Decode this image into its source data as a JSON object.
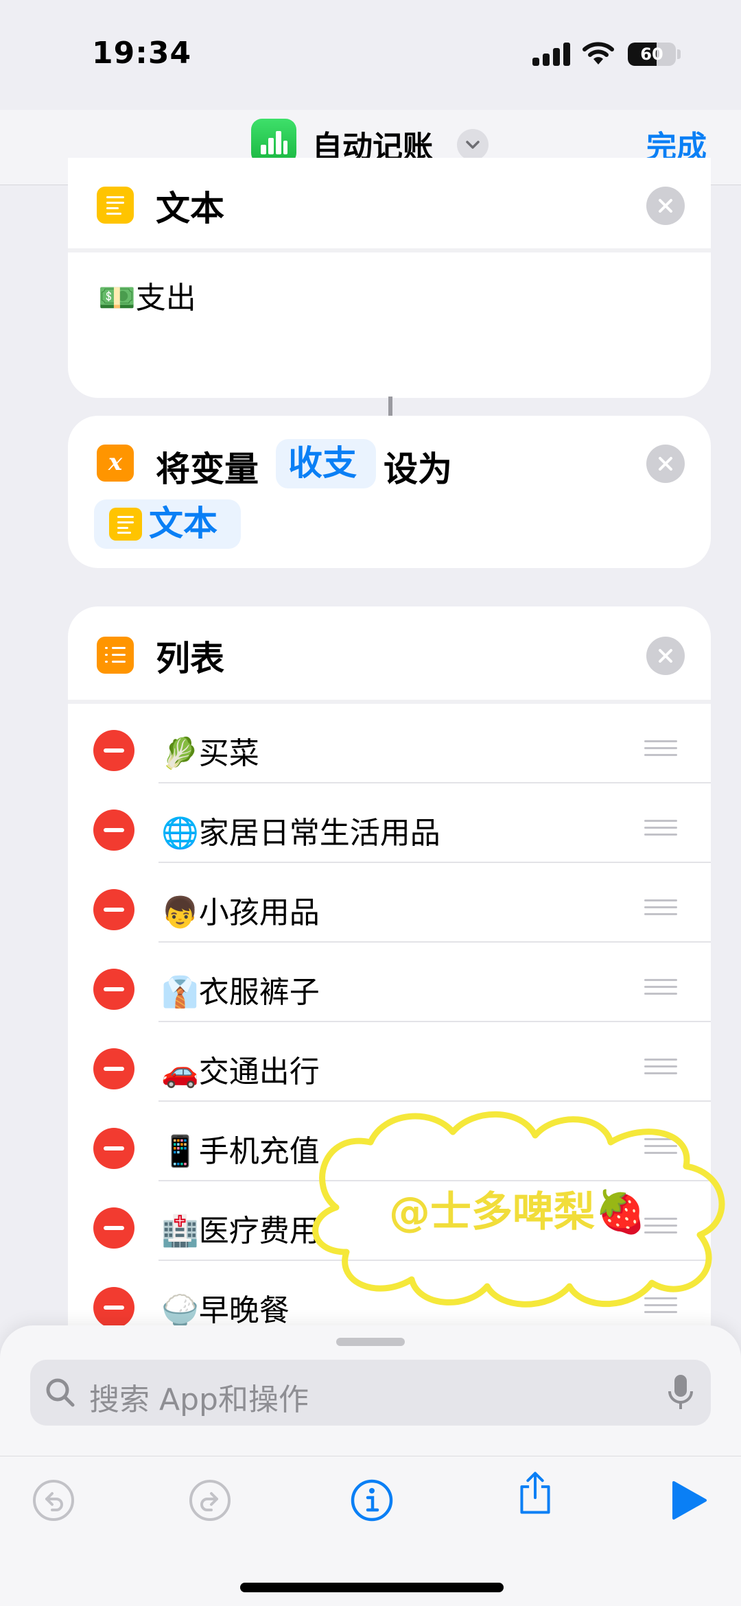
{
  "status_bar": {
    "time": "19:34",
    "battery_level": "60",
    "battery_percent": 60
  },
  "nav": {
    "title": "自动记账",
    "done_label": "完成"
  },
  "text_action": {
    "title": "文本",
    "content": "💵支出"
  },
  "set_variable": {
    "prefix": "将变量",
    "variable": "收支",
    "middle": "设为",
    "value": "文本"
  },
  "list_action": {
    "title": "列表",
    "items": [
      {
        "label": "🥬买菜"
      },
      {
        "label": "🌐家居日常生活用品"
      },
      {
        "label": "👦小孩用品"
      },
      {
        "label": "👔衣服裤子"
      },
      {
        "label": "🚗交通出行"
      },
      {
        "label": "📱手机充值"
      },
      {
        "label": "🏥医疗费用"
      },
      {
        "label": "🍚早晚餐"
      }
    ]
  },
  "search": {
    "placeholder": "搜索 App和操作"
  },
  "watermark": {
    "text": "@士多啤梨🍓"
  },
  "icons": {
    "app": "numbers-chart-icon",
    "chevron": "chevron-down-icon",
    "text": "text-icon",
    "variable": "variable-x-icon",
    "list": "list-icon",
    "close": "close-icon",
    "search": "magnifier-icon",
    "mic": "microphone-icon",
    "undo": "undo-icon",
    "redo": "redo-icon",
    "info": "info-icon",
    "share": "share-icon",
    "run": "play-icon"
  },
  "colors": {
    "accent": "#0A7FF5",
    "delete": "#F23B30",
    "text_icon": "#FFC400",
    "variable_icon": "#FF9500",
    "app_green": "#23C244"
  }
}
